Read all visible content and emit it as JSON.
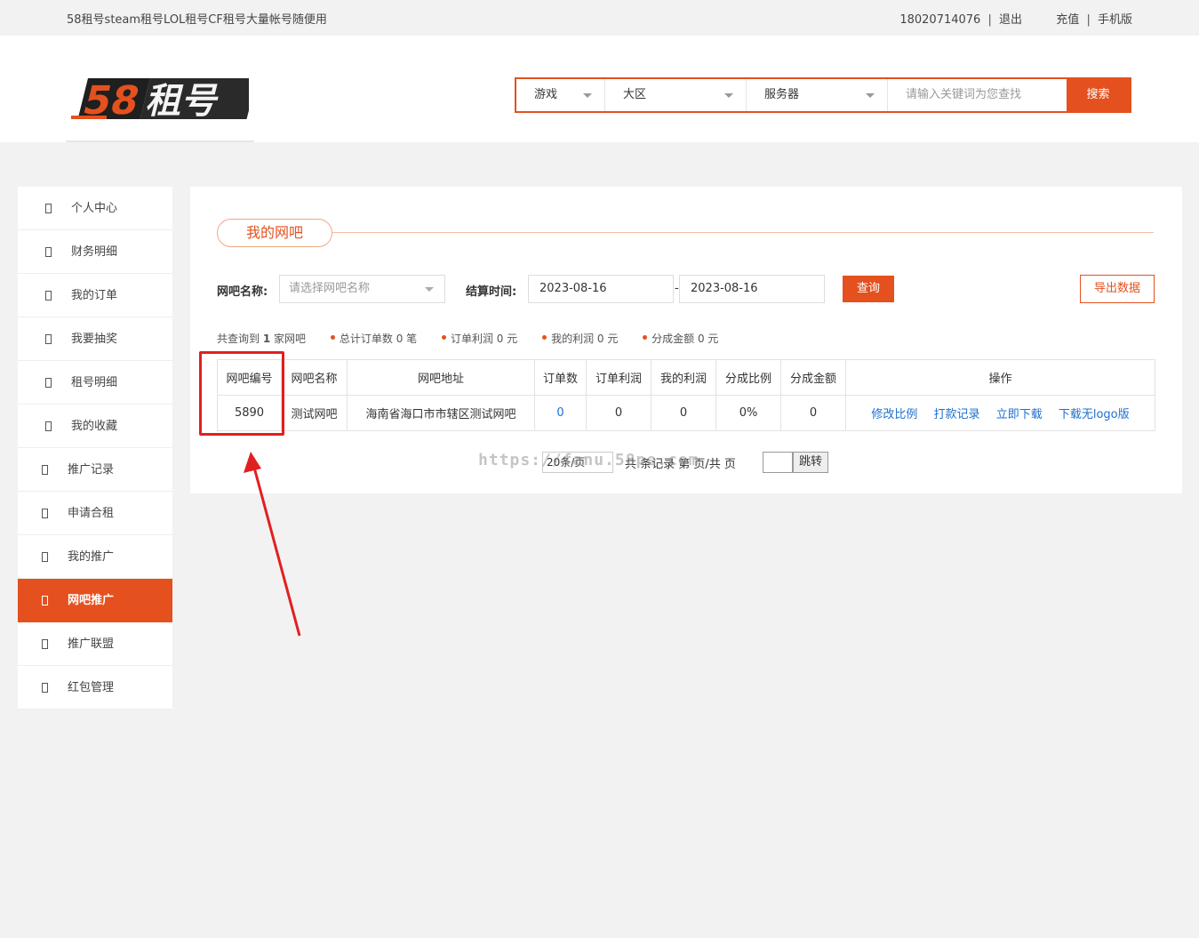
{
  "topbar": {
    "slogan": "58租号steam租号LOL租号CF租号大量帐号随便用",
    "phone": "18020714076",
    "logout": "退出",
    "recharge": "充值",
    "mobile": "手机版",
    "sep": "|"
  },
  "logo": {
    "text": "58租号"
  },
  "search": {
    "game": "游戏",
    "region": "大区",
    "server": "服务器",
    "placeholder": "请输入关键词为您查找",
    "button": "搜索"
  },
  "sidebar": {
    "items": [
      {
        "label": "个人中心",
        "active": false
      },
      {
        "label": "财务明细",
        "active": false
      },
      {
        "label": "我的订单",
        "active": false
      },
      {
        "label": "我要抽奖",
        "active": false
      },
      {
        "label": "租号明细",
        "active": false
      },
      {
        "label": "我的收藏",
        "active": false
      },
      {
        "label": "推广记录",
        "active": false
      },
      {
        "label": "申请合租",
        "active": false
      },
      {
        "label": "我的推广",
        "active": false
      },
      {
        "label": "网吧推广",
        "active": true
      },
      {
        "label": "推广联盟",
        "active": false
      },
      {
        "label": "红包管理",
        "active": false
      }
    ]
  },
  "main": {
    "title": "我的网吧",
    "filters": {
      "name_label": "网吧名称:",
      "name_placeholder": "请选择网吧名称",
      "time_label": "结算时间:",
      "date_from": "2023-08-16",
      "dash": "-",
      "date_to": "2023-08-16",
      "query": "查询",
      "export": "导出数据"
    },
    "stats": {
      "prefix": "共查询到",
      "count": "1",
      "suffix": "家网吧",
      "orders": "总计订单数 0 笔",
      "order_profit": "订单利润 0 元",
      "my_profit": "我的利润 0 元",
      "share_amount": "分成金额 0 元"
    },
    "table": {
      "headers": [
        "网吧编号",
        "网吧名称",
        "网吧地址",
        "订单数",
        "订单利润",
        "我的利润",
        "分成比例",
        "分成金额",
        "操作"
      ],
      "rows": [
        {
          "id": "5890",
          "name": "测试网吧",
          "address": "海南省海口市市辖区测试网吧",
          "orders": "0",
          "order_profit": "0",
          "my_profit": "0",
          "ratio": "0%",
          "amount": "0",
          "ops": [
            "修改比例",
            "打款记录",
            "立即下载",
            "下载无logo版"
          ]
        }
      ]
    },
    "pager": {
      "per_page": "20条/页",
      "info": "共 条记录 第 页/共 页",
      "go": "跳转"
    },
    "watermark": "https://fanu.58pe.com"
  },
  "colors": {
    "accent": "#e4511f",
    "link": "#1e6fd0",
    "highlight": "#e02020"
  }
}
